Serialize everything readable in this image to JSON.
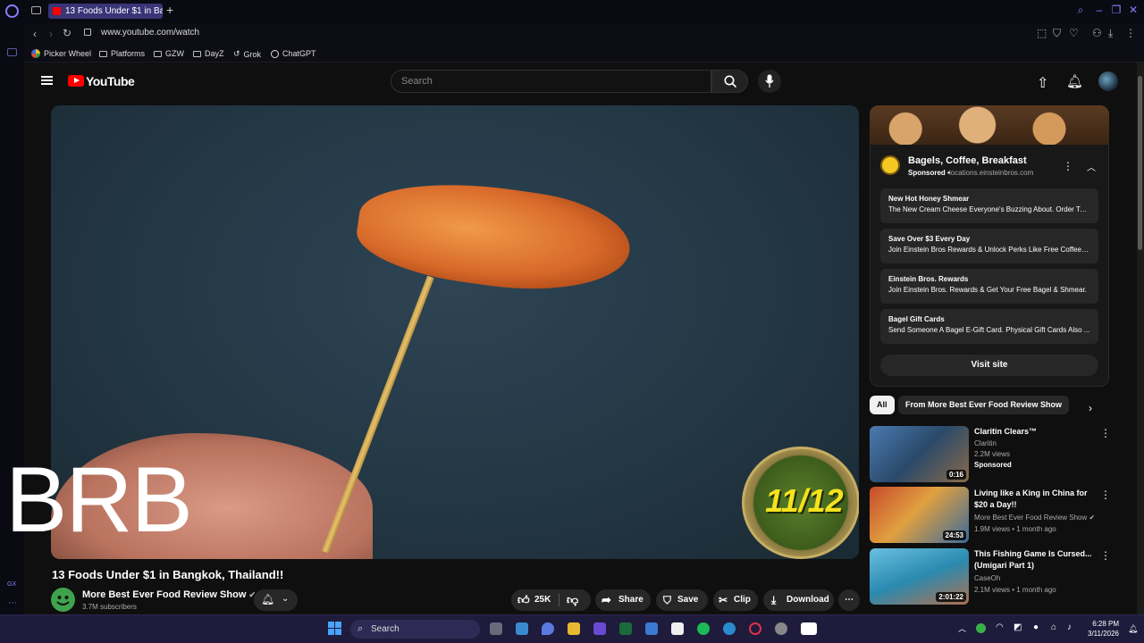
{
  "browser": {
    "tab_title": "13 Foods Under $1 in Ba",
    "url": "www.youtube.com/watch",
    "bookmarks": [
      "Picker Wheel",
      "Platforms",
      "GZW",
      "DayZ",
      "Grok",
      "ChatGPT"
    ],
    "sidebar_label": "GX",
    "colors": {
      "accent": "#8a7cff",
      "tab_active": "#3a3577"
    }
  },
  "youtube": {
    "logo_text": "YouTube",
    "search_placeholder": "Search",
    "video": {
      "title": "13 Foods Under $1 in Bangkok, Thailand!!",
      "badge": "11/12",
      "overlay_text": "BRB"
    },
    "channel": {
      "name": "More Best Ever Food Review Show",
      "subscribers": "3.7M subscribers"
    },
    "actions": {
      "likes": "25K",
      "share": "Share",
      "save": "Save",
      "clip": "Clip",
      "download": "Download"
    },
    "ad": {
      "title": "Bagels, Coffee, Breakfast",
      "sponsored": "Sponsored",
      "domain": "locations.einsteinbros.com",
      "rows": [
        {
          "title": "New Hot Honey Shmear",
          "subtitle": "The New Cream Cheese Everyone's Buzzing About. Order Tod..."
        },
        {
          "title": "Save Over $3 Every Day",
          "subtitle": "Join Einstein Bros Rewards & Unlock Perks Like Free Coffee E..."
        },
        {
          "title": "Einstein Bros. Rewards",
          "subtitle": "Join Einstein Bros. Rewards & Get Your Free Bagel & Shmear."
        },
        {
          "title": "Bagel Gift Cards",
          "subtitle": "Send Someone A Bagel E-Gift Card. Physical Gift Cards Also ..."
        }
      ],
      "cta": "Visit site"
    },
    "chips": [
      "All",
      "From More Best Ever Food Review Show"
    ],
    "recommendations": [
      {
        "title": "Claritin Clears™",
        "channel": "Claritin",
        "views": "2.2M views",
        "extra": "Sponsored",
        "duration": "0:16"
      },
      {
        "title": "Living like a King in China for $20 a Day!!",
        "channel": "More Best Ever Food Review Show",
        "views": "1.9M views • 1 month ago",
        "duration": "24:53"
      },
      {
        "title": "This Fishing Game Is Cursed... (Umigari Part 1)",
        "channel": "CaseOh",
        "views": "2.1M views • 1 month ago",
        "duration": "2:01:22"
      }
    ]
  },
  "taskbar": {
    "search": "Search",
    "time": "6:28 PM",
    "date": "3/11/2026"
  }
}
